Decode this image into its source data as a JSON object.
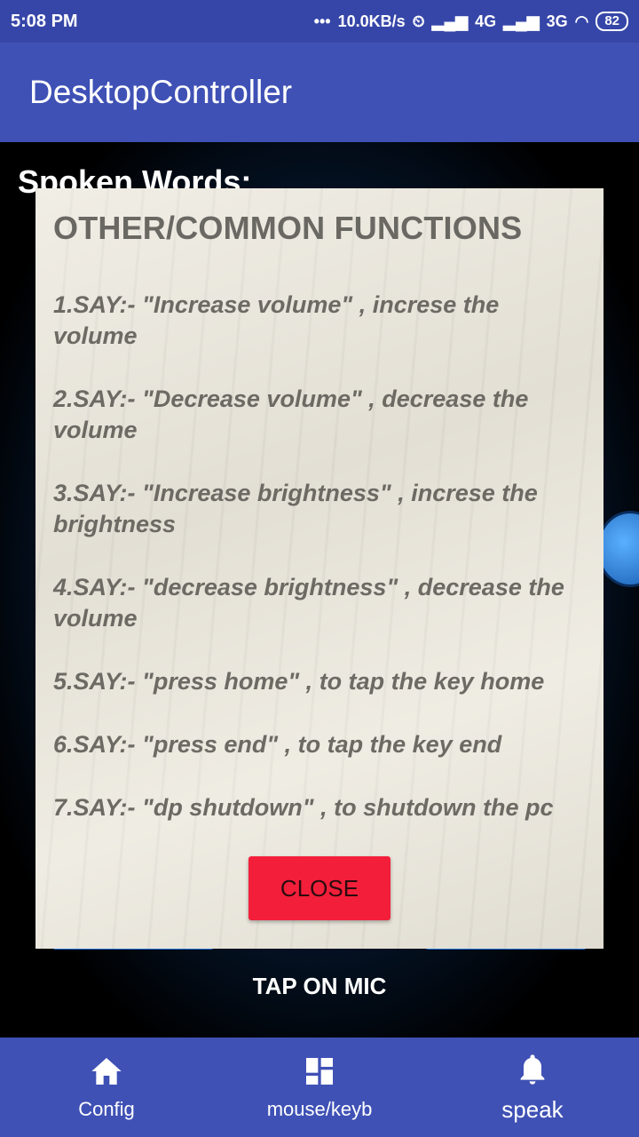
{
  "status_bar": {
    "time": "5:08 PM",
    "dots": "•••",
    "network_speed": "10.0KB/s",
    "signal_1": "4G",
    "signal_2": "3G",
    "battery": "82"
  },
  "app_bar": {
    "title": "DesktopController"
  },
  "background": {
    "spoken_words_label": "Spoken Words:",
    "tap_label": "TAP ON MIC"
  },
  "dialog": {
    "title": "OTHER/COMMON FUNCTIONS",
    "items": [
      "1.SAY:- \"Increase volume\" , increse the volume",
      "2.SAY:- \"Decrease volume\" , decrease the volume",
      "3.SAY:- \"Increase brightness\" , increse the brightness",
      "4.SAY:- \"decrease brightness\" , decrease the volume",
      "5.SAY:- \"press home\" , to tap the key home",
      "6.SAY:- \"press end\" , to tap the key end",
      "7.SAY:- \"dp shutdown\" , to shutdown the pc"
    ],
    "close_label": "CLOSE"
  },
  "bottom_nav": {
    "items": [
      {
        "label": "Config",
        "icon": "home-icon"
      },
      {
        "label": "mouse/keyb",
        "icon": "dashboard-icon"
      },
      {
        "label": "speak",
        "icon": "bell-icon"
      }
    ]
  },
  "colors": {
    "primary": "#3f51b5",
    "status_bar": "#3646a8",
    "close_button": "#f31f3a",
    "dialog_bg": "#ece8dd",
    "dialog_text": "#6d6a64"
  }
}
